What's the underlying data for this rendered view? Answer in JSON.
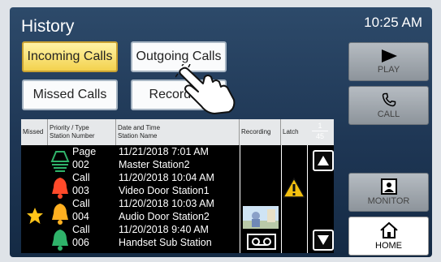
{
  "header": {
    "title": "History",
    "time": "10:25 AM"
  },
  "tabs": [
    {
      "label": "Incoming Calls",
      "active": true
    },
    {
      "label": "Outgoing Calls",
      "active": false
    },
    {
      "label": "Missed Calls",
      "active": false
    },
    {
      "label": "Recording",
      "active": false
    }
  ],
  "table": {
    "headers": {
      "missed": "Missed",
      "priority_type": "Priority / Type",
      "station_number": "Station Number",
      "date_time": "Date and Time",
      "station_name": "Station Name",
      "recording": "Recording",
      "latch": "Latch"
    },
    "rows": [
      {
        "type": "Page",
        "number": "002",
        "datetime": "11/21/2018  7:01 AM",
        "station": "Master Station2",
        "bell_color": "#2fb36a",
        "missed": false,
        "recording": "",
        "latch": ""
      },
      {
        "type": "Call",
        "number": "003",
        "datetime": "11/20/2018 10:04 AM",
        "station": "Video Door Station1",
        "bell_color": "#ff4a2a",
        "missed": false,
        "recording": "",
        "latch": "warning-icon"
      },
      {
        "type": "Call",
        "number": "004",
        "datetime": "11/20/2018 10:03 AM",
        "station": "Audio Door Station2",
        "bell_color": "#ffb020",
        "missed": true,
        "recording": "video-thumbnail",
        "latch": ""
      },
      {
        "type": "Call",
        "number": "006",
        "datetime": "11/20/2018  9:40 AM",
        "station": "Handset Sub Station",
        "bell_color": "#2fb36a",
        "missed": false,
        "recording": "tape-icon",
        "latch": ""
      }
    ]
  },
  "pager": {
    "current": "1",
    "total": "45"
  },
  "buttons": {
    "play": "PLAY",
    "call": "CALL",
    "monitor": "MONITOR",
    "home": "HOME"
  },
  "colors": {
    "accent": "#f3d24e",
    "background": "#1e3654"
  }
}
